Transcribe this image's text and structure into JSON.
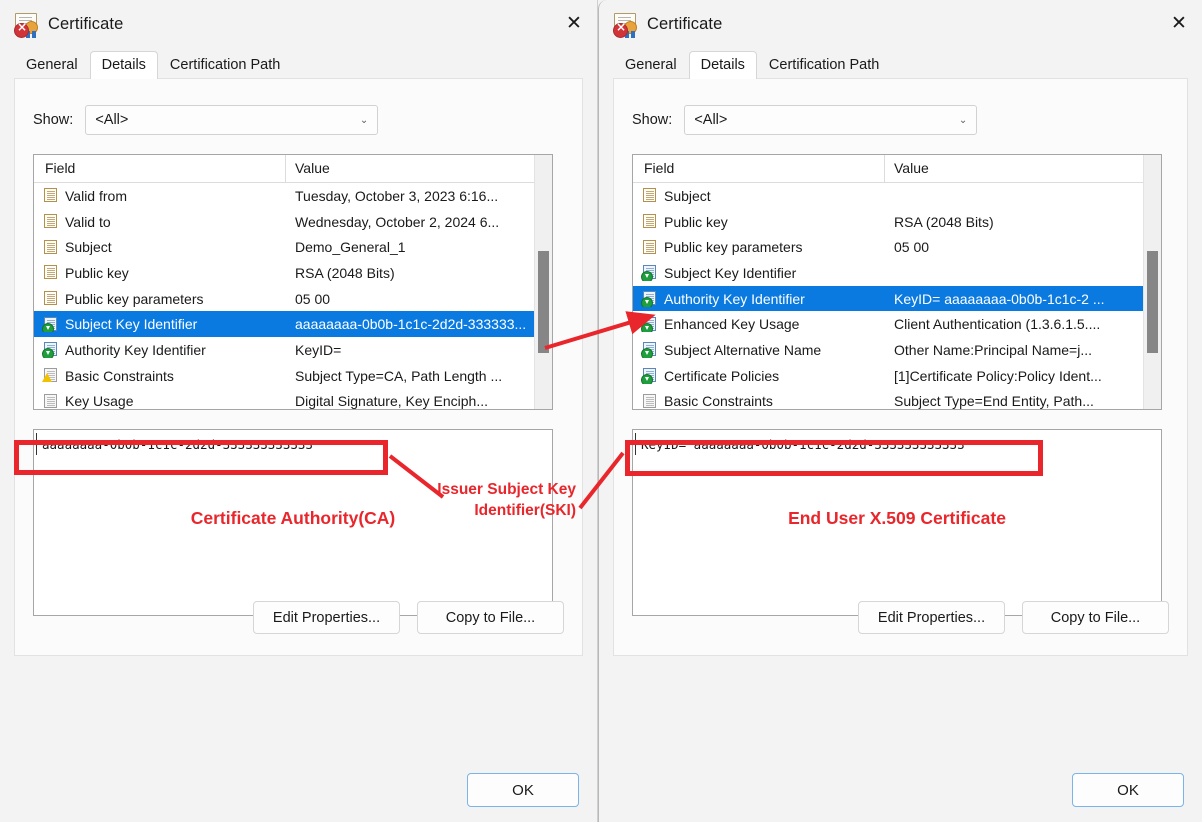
{
  "left_dialog": {
    "title": "Certificate",
    "icon": "certificate-revoked-icon",
    "close_label": "✕",
    "tabs": [
      {
        "label": "General",
        "active": false
      },
      {
        "label": "Details",
        "active": true
      },
      {
        "label": "Certification Path",
        "active": false
      }
    ],
    "show": {
      "label": "Show:",
      "value": "<All>",
      "chevron": "⌄"
    },
    "list": {
      "columns": [
        "Field",
        "Value"
      ],
      "rows": [
        {
          "icon": "field-page-icon",
          "field": "Valid from",
          "value": "Tuesday, October 3, 2023 6:16...",
          "selected": false
        },
        {
          "icon": "field-page-icon",
          "field": "Valid to",
          "value": "Wednesday, October 2, 2024 6...",
          "selected": false
        },
        {
          "icon": "field-page-icon",
          "field": "Subject",
          "value": "Demo_General_1",
          "selected": false
        },
        {
          "icon": "field-page-icon",
          "field": "Public key",
          "value": "RSA (2048 Bits)",
          "selected": false
        },
        {
          "icon": "field-page-icon",
          "field": "Public key parameters",
          "value": "05 00",
          "selected": false
        },
        {
          "icon": "field-extension-icon",
          "field": "Subject Key Identifier",
          "value": "aaaaaaaa-0b0b-1c1c-2d2d-333333...",
          "selected": true
        },
        {
          "icon": "field-extension-icon",
          "field": "Authority Key Identifier",
          "value": "KeyID=",
          "selected": false
        },
        {
          "icon": "field-warning-icon",
          "field": "Basic Constraints",
          "value": "Subject Type=CA, Path Length ...",
          "selected": false
        },
        {
          "icon": "field-gray-icon",
          "field": "Key Usage",
          "value": "Digital Signature, Key Enciph...",
          "selected": false
        }
      ]
    },
    "value_box": {
      "text": "aaaaaaaa-0b0b-1c1c-2d2d-333333333333",
      "annotation": "Certificate Authority(CA)"
    },
    "buttons": {
      "edit": "Edit Properties...",
      "copy": "Copy to File...",
      "ok": "OK"
    }
  },
  "right_dialog": {
    "title": "Certificate",
    "icon": "certificate-revoked-icon",
    "close_label": "✕",
    "tabs": [
      {
        "label": "General",
        "active": false
      },
      {
        "label": "Details",
        "active": true
      },
      {
        "label": "Certification Path",
        "active": false
      }
    ],
    "show": {
      "label": "Show:",
      "value": "<All>",
      "chevron": "⌄"
    },
    "list": {
      "columns": [
        "Field",
        "Value"
      ],
      "rows": [
        {
          "icon": "field-page-icon",
          "field": "Subject",
          "value": "",
          "selected": false
        },
        {
          "icon": "field-page-icon",
          "field": "Public key",
          "value": "RSA (2048 Bits)",
          "selected": false
        },
        {
          "icon": "field-page-icon",
          "field": "Public key parameters",
          "value": "05 00",
          "selected": false
        },
        {
          "icon": "field-extension-icon",
          "field": "Subject Key Identifier",
          "value": "",
          "selected": false
        },
        {
          "icon": "field-extension-icon",
          "field": "Authority Key Identifier",
          "value": "KeyID= aaaaaaaa-0b0b-1c1c-2 ...",
          "selected": true
        },
        {
          "icon": "field-extension-icon",
          "field": "Enhanced Key Usage",
          "value": "Client Authentication (1.3.6.1.5....",
          "selected": false
        },
        {
          "icon": "field-extension-icon",
          "field": "Subject Alternative Name",
          "value": "Other Name:Principal Name=j...",
          "selected": false
        },
        {
          "icon": "field-extension-icon",
          "field": "Certificate Policies",
          "value": "[1]Certificate Policy:Policy Ident...",
          "selected": false
        },
        {
          "icon": "field-gray-icon",
          "field": "Basic Constraints",
          "value": "Subject Type=End Entity, Path...",
          "selected": false
        }
      ]
    },
    "value_box": {
      "text": "KeyID= aaaaaaaa-0b0b-1c1c-2d2d-333333333333",
      "annotation": "End User X.509 Certificate"
    },
    "buttons": {
      "edit": "Edit Properties...",
      "copy": "Copy to File...",
      "ok": "OK"
    }
  },
  "annotations": {
    "ski_label_line1": "Issuer Subject Key",
    "ski_label_line2": "Identifier(SKI)",
    "accent_color": "#e8262b",
    "selection_color": "#0a7ae0"
  }
}
